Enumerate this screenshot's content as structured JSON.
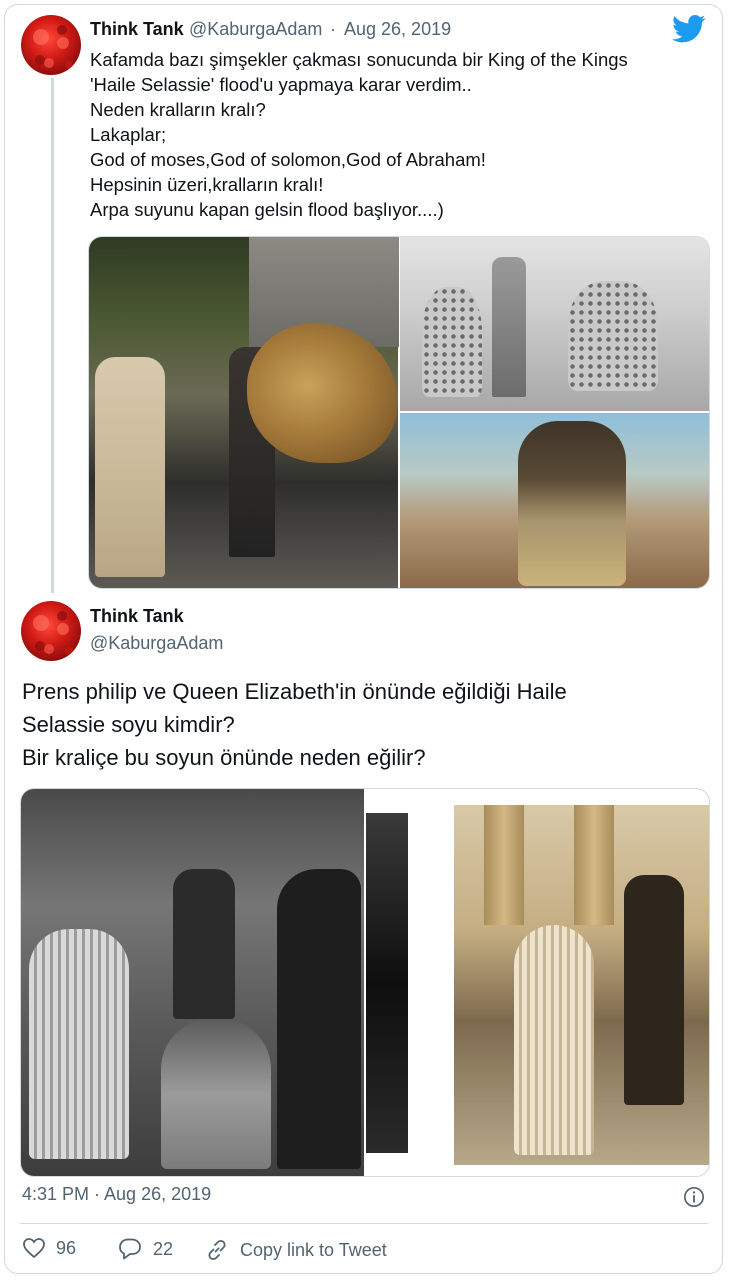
{
  "tweet1": {
    "name": "Think Tank",
    "handle": "@KaburgaAdam",
    "separator": "·",
    "date": "Aug 26, 2019",
    "lines": [
      "Kafamda bazı şimşekler çakması sonucunda bir King of the Kings",
      "'Haile Selassie' flood'u yapmaya karar verdim..",
      "Neden kralların kralı?",
      "Lakaplar;",
      "God of moses,God of solomon,God of Abraham!",
      "Hepsinin üzeri,kralların kralı!",
      "Arpa suyunu kapan gelsin flood başlıyor....)"
    ]
  },
  "tweet2": {
    "name": "Think Tank",
    "handle": "@KaburgaAdam",
    "lines": [
      "Prens philip ve Queen Elizabeth'in önünde eğildiği Haile",
      "Selassie soyu kimdir?",
      "Bir kraliçe bu soyun önünde neden eğilir?"
    ],
    "timestamp": "4:31 PM · Aug 26, 2019"
  },
  "actions": {
    "likes": "96",
    "replies": "22",
    "copy_link": "Copy link to Tweet"
  },
  "colors": {
    "twitter_blue": "#1d9bf0",
    "text_primary": "#0f1419",
    "text_secondary": "#536471",
    "border": "#cfd9de"
  }
}
